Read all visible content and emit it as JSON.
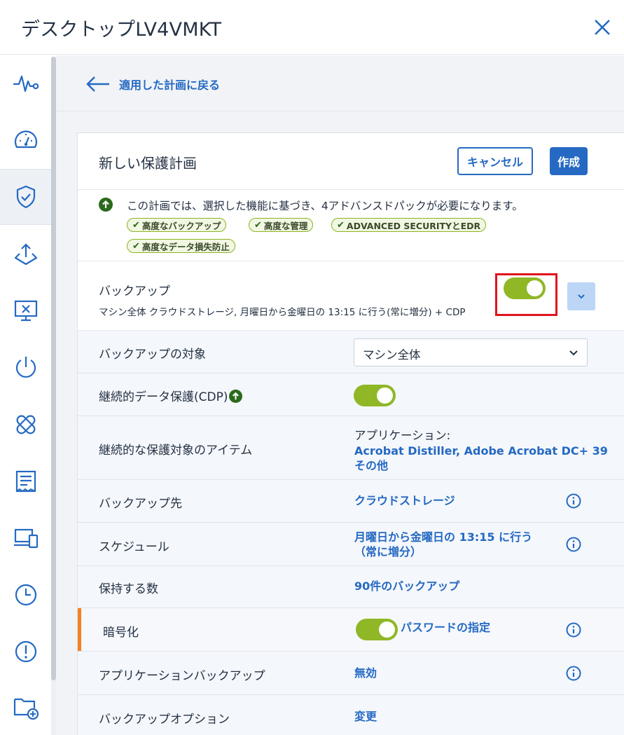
{
  "window": {
    "title": "デスクトップLV4VMKT"
  },
  "sidebar": {
    "items": [
      {
        "name": "monitoring"
      },
      {
        "name": "dashboard"
      },
      {
        "name": "protection"
      },
      {
        "name": "deploy"
      },
      {
        "name": "remote-desktop"
      },
      {
        "name": "power"
      },
      {
        "name": "patch"
      },
      {
        "name": "reports"
      },
      {
        "name": "devices"
      },
      {
        "name": "schedule"
      },
      {
        "name": "alerts"
      },
      {
        "name": "add-folder"
      }
    ]
  },
  "back": {
    "label": "適用した計画に戻る"
  },
  "plan": {
    "title": "新しい保護計画",
    "cancel_label": "キャンセル",
    "create_label": "作成"
  },
  "notice": {
    "text": "この計画では、選択した機能に基づき、4アドバンスドパックが必要になります。",
    "tags": [
      "高度なバックアップ",
      "高度な管理",
      "ADVANCED SECURITYとEDR",
      "高度なデータ損失防止"
    ]
  },
  "backup": {
    "name": "バックアップ",
    "summary": "マシン全体 クラウドストレージ, 月曜日から金曜日の 13:15 に行う(常に増分) + CDP",
    "enabled": true
  },
  "rows": {
    "target": {
      "label": "バックアップの対象",
      "value": "マシン全体"
    },
    "cdp": {
      "label": "継続的データ保護(CDP)",
      "enabled": true
    },
    "cdp_items": {
      "label": "継続的な保護対象のアイテム",
      "prefix": "アプリケーション:",
      "value_line1": "Acrobat Distiller, Adobe Acrobat DC+ 39",
      "value_line2": "その他"
    },
    "destination": {
      "label": "バックアップ先",
      "value": "クラウドストレージ"
    },
    "schedule": {
      "label": "スケジュール",
      "value_line1": "月曜日から金曜日の 13:15 に行う",
      "value_line2": "（常に増分）"
    },
    "retention": {
      "label": "保持する数",
      "value": "90件のバックアップ"
    },
    "encryption": {
      "label": "暗号化",
      "value": "パスワードの指定",
      "enabled": true
    },
    "app_backup": {
      "label": "アプリケーションバックアップ",
      "value": "無効"
    },
    "options": {
      "label": "バックアップオプション",
      "value": "変更"
    }
  },
  "colors": {
    "accent_blue": "#2569c3",
    "toggle_green": "#8fb726",
    "highlight_red": "#e0141e",
    "warning_orange": "#f5821f"
  }
}
